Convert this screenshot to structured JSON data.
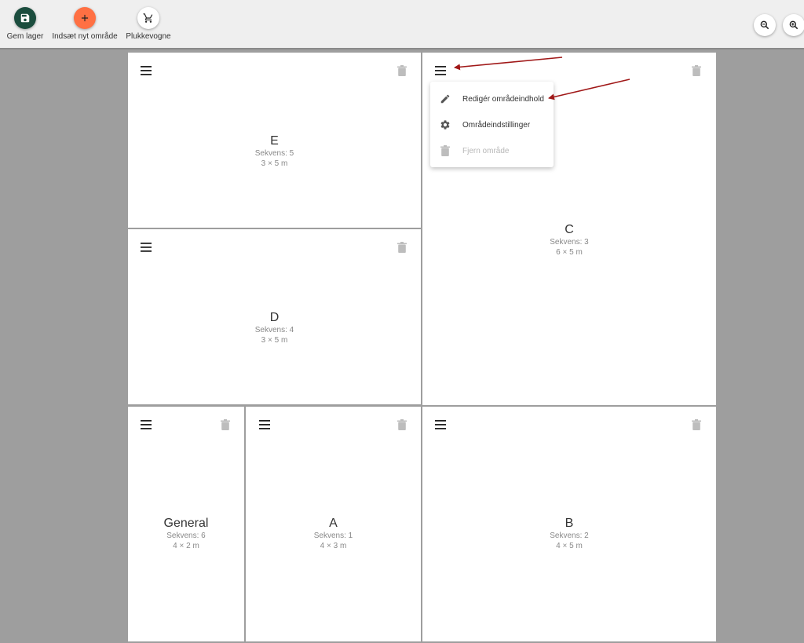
{
  "toolbar": {
    "save_label": "Gem lager",
    "insert_label": "Indsæt nyt område",
    "carts_label": "Plukkevogne",
    "colors": {
      "save": "#1b4d3e",
      "insert": "#ff7043",
      "carts": "#ffffff"
    }
  },
  "areas": {
    "e": {
      "name": "E",
      "sequence": "Sekvens: 5",
      "size": "3 × 5 m"
    },
    "c": {
      "name": "C",
      "sequence": "Sekvens: 3",
      "size": "6 × 5 m"
    },
    "d": {
      "name": "D",
      "sequence": "Sekvens: 4",
      "size": "3 × 5 m"
    },
    "general": {
      "name": "General",
      "sequence": "Sekvens: 6",
      "size": "4 × 2 m"
    },
    "a": {
      "name": "A",
      "sequence": "Sekvens: 1",
      "size": "4 × 3 m"
    },
    "b": {
      "name": "B",
      "sequence": "Sekvens: 2",
      "size": "4 × 5 m"
    }
  },
  "menu": {
    "edit_label": "Redigér områdeindhold",
    "settings_label": "Områdeindstillinger",
    "remove_label": "Fjern område"
  },
  "icons": [
    "save-icon",
    "plus-icon",
    "cart-icon",
    "zoom-out-icon",
    "zoom-in-icon",
    "menu-icon",
    "trash-icon",
    "pencil-icon",
    "gear-icon"
  ],
  "annotation_color": "#a01818"
}
